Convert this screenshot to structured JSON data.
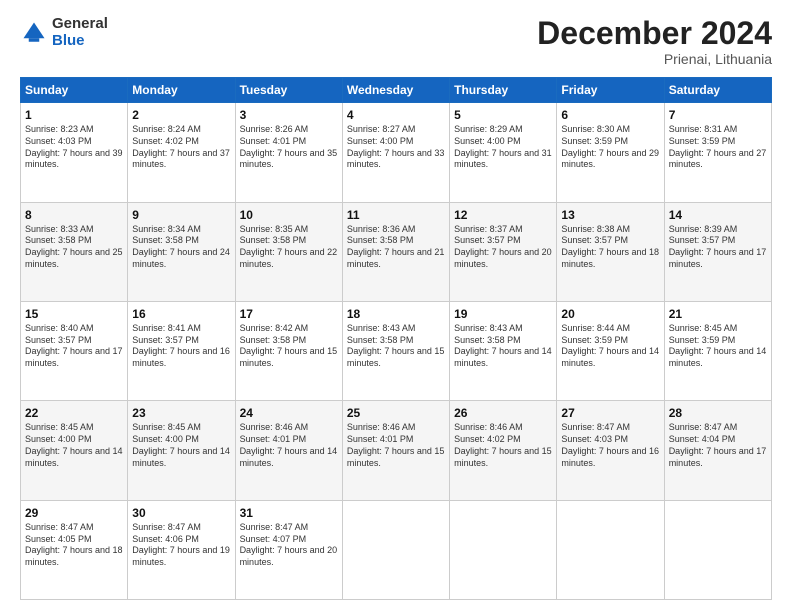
{
  "header": {
    "logo_general": "General",
    "logo_blue": "Blue",
    "month_title": "December 2024",
    "location": "Prienai, Lithuania"
  },
  "days_of_week": [
    "Sunday",
    "Monday",
    "Tuesday",
    "Wednesday",
    "Thursday",
    "Friday",
    "Saturday"
  ],
  "weeks": [
    [
      {
        "day": "1",
        "sunrise": "Sunrise: 8:23 AM",
        "sunset": "Sunset: 4:03 PM",
        "daylight": "Daylight: 7 hours and 39 minutes."
      },
      {
        "day": "2",
        "sunrise": "Sunrise: 8:24 AM",
        "sunset": "Sunset: 4:02 PM",
        "daylight": "Daylight: 7 hours and 37 minutes."
      },
      {
        "day": "3",
        "sunrise": "Sunrise: 8:26 AM",
        "sunset": "Sunset: 4:01 PM",
        "daylight": "Daylight: 7 hours and 35 minutes."
      },
      {
        "day": "4",
        "sunrise": "Sunrise: 8:27 AM",
        "sunset": "Sunset: 4:00 PM",
        "daylight": "Daylight: 7 hours and 33 minutes."
      },
      {
        "day": "5",
        "sunrise": "Sunrise: 8:29 AM",
        "sunset": "Sunset: 4:00 PM",
        "daylight": "Daylight: 7 hours and 31 minutes."
      },
      {
        "day": "6",
        "sunrise": "Sunrise: 8:30 AM",
        "sunset": "Sunset: 3:59 PM",
        "daylight": "Daylight: 7 hours and 29 minutes."
      },
      {
        "day": "7",
        "sunrise": "Sunrise: 8:31 AM",
        "sunset": "Sunset: 3:59 PM",
        "daylight": "Daylight: 7 hours and 27 minutes."
      }
    ],
    [
      {
        "day": "8",
        "sunrise": "Sunrise: 8:33 AM",
        "sunset": "Sunset: 3:58 PM",
        "daylight": "Daylight: 7 hours and 25 minutes."
      },
      {
        "day": "9",
        "sunrise": "Sunrise: 8:34 AM",
        "sunset": "Sunset: 3:58 PM",
        "daylight": "Daylight: 7 hours and 24 minutes."
      },
      {
        "day": "10",
        "sunrise": "Sunrise: 8:35 AM",
        "sunset": "Sunset: 3:58 PM",
        "daylight": "Daylight: 7 hours and 22 minutes."
      },
      {
        "day": "11",
        "sunrise": "Sunrise: 8:36 AM",
        "sunset": "Sunset: 3:58 PM",
        "daylight": "Daylight: 7 hours and 21 minutes."
      },
      {
        "day": "12",
        "sunrise": "Sunrise: 8:37 AM",
        "sunset": "Sunset: 3:57 PM",
        "daylight": "Daylight: 7 hours and 20 minutes."
      },
      {
        "day": "13",
        "sunrise": "Sunrise: 8:38 AM",
        "sunset": "Sunset: 3:57 PM",
        "daylight": "Daylight: 7 hours and 18 minutes."
      },
      {
        "day": "14",
        "sunrise": "Sunrise: 8:39 AM",
        "sunset": "Sunset: 3:57 PM",
        "daylight": "Daylight: 7 hours and 17 minutes."
      }
    ],
    [
      {
        "day": "15",
        "sunrise": "Sunrise: 8:40 AM",
        "sunset": "Sunset: 3:57 PM",
        "daylight": "Daylight: 7 hours and 17 minutes."
      },
      {
        "day": "16",
        "sunrise": "Sunrise: 8:41 AM",
        "sunset": "Sunset: 3:57 PM",
        "daylight": "Daylight: 7 hours and 16 minutes."
      },
      {
        "day": "17",
        "sunrise": "Sunrise: 8:42 AM",
        "sunset": "Sunset: 3:58 PM",
        "daylight": "Daylight: 7 hours and 15 minutes."
      },
      {
        "day": "18",
        "sunrise": "Sunrise: 8:43 AM",
        "sunset": "Sunset: 3:58 PM",
        "daylight": "Daylight: 7 hours and 15 minutes."
      },
      {
        "day": "19",
        "sunrise": "Sunrise: 8:43 AM",
        "sunset": "Sunset: 3:58 PM",
        "daylight": "Daylight: 7 hours and 14 minutes."
      },
      {
        "day": "20",
        "sunrise": "Sunrise: 8:44 AM",
        "sunset": "Sunset: 3:59 PM",
        "daylight": "Daylight: 7 hours and 14 minutes."
      },
      {
        "day": "21",
        "sunrise": "Sunrise: 8:45 AM",
        "sunset": "Sunset: 3:59 PM",
        "daylight": "Daylight: 7 hours and 14 minutes."
      }
    ],
    [
      {
        "day": "22",
        "sunrise": "Sunrise: 8:45 AM",
        "sunset": "Sunset: 4:00 PM",
        "daylight": "Daylight: 7 hours and 14 minutes."
      },
      {
        "day": "23",
        "sunrise": "Sunrise: 8:45 AM",
        "sunset": "Sunset: 4:00 PM",
        "daylight": "Daylight: 7 hours and 14 minutes."
      },
      {
        "day": "24",
        "sunrise": "Sunrise: 8:46 AM",
        "sunset": "Sunset: 4:01 PM",
        "daylight": "Daylight: 7 hours and 14 minutes."
      },
      {
        "day": "25",
        "sunrise": "Sunrise: 8:46 AM",
        "sunset": "Sunset: 4:01 PM",
        "daylight": "Daylight: 7 hours and 15 minutes."
      },
      {
        "day": "26",
        "sunrise": "Sunrise: 8:46 AM",
        "sunset": "Sunset: 4:02 PM",
        "daylight": "Daylight: 7 hours and 15 minutes."
      },
      {
        "day": "27",
        "sunrise": "Sunrise: 8:47 AM",
        "sunset": "Sunset: 4:03 PM",
        "daylight": "Daylight: 7 hours and 16 minutes."
      },
      {
        "day": "28",
        "sunrise": "Sunrise: 8:47 AM",
        "sunset": "Sunset: 4:04 PM",
        "daylight": "Daylight: 7 hours and 17 minutes."
      }
    ],
    [
      {
        "day": "29",
        "sunrise": "Sunrise: 8:47 AM",
        "sunset": "Sunset: 4:05 PM",
        "daylight": "Daylight: 7 hours and 18 minutes."
      },
      {
        "day": "30",
        "sunrise": "Sunrise: 8:47 AM",
        "sunset": "Sunset: 4:06 PM",
        "daylight": "Daylight: 7 hours and 19 minutes."
      },
      {
        "day": "31",
        "sunrise": "Sunrise: 8:47 AM",
        "sunset": "Sunset: 4:07 PM",
        "daylight": "Daylight: 7 hours and 20 minutes."
      },
      null,
      null,
      null,
      null
    ]
  ]
}
